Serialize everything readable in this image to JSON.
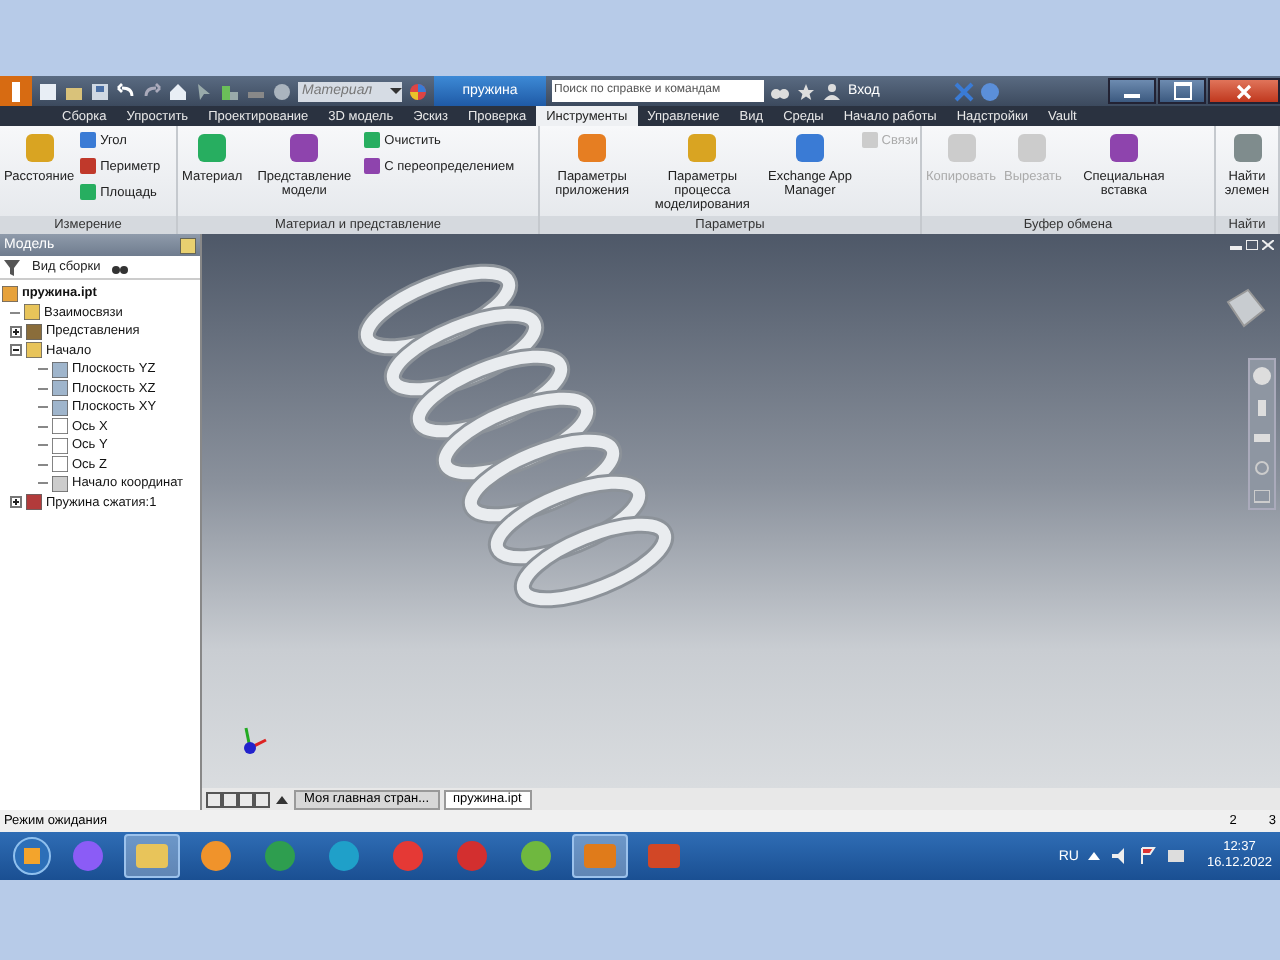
{
  "quick_access": {
    "material": "Материал"
  },
  "title": "пружина",
  "search": {
    "placeholder": "Поиск по справке и командам"
  },
  "sign_in": "Вход",
  "tabs": [
    {
      "label": "Сборка",
      "selected": false
    },
    {
      "label": "Упростить",
      "selected": false
    },
    {
      "label": "Проектирование",
      "selected": false
    },
    {
      "label": "3D модель",
      "selected": false
    },
    {
      "label": "Эскиз",
      "selected": false
    },
    {
      "label": "Проверка",
      "selected": false
    },
    {
      "label": "Инструменты",
      "selected": true
    },
    {
      "label": "Управление",
      "selected": false
    },
    {
      "label": "Вид",
      "selected": false
    },
    {
      "label": "Среды",
      "selected": false
    },
    {
      "label": "Начало работы",
      "selected": false
    },
    {
      "label": "Надстройки",
      "selected": false
    },
    {
      "label": "Vault",
      "selected": false
    }
  ],
  "panels": [
    {
      "title": "Измерение",
      "buttons": [
        {
          "label": "Расстояние",
          "kind": "large",
          "disabled": false
        },
        {
          "label": "Угол",
          "kind": "small",
          "disabled": false
        },
        {
          "label": "Периметр",
          "kind": "small",
          "disabled": false
        },
        {
          "label": "Площадь",
          "kind": "small",
          "disabled": false
        }
      ]
    },
    {
      "title": "Материал и представление",
      "buttons": [
        {
          "label": "Материал",
          "kind": "large",
          "disabled": false
        },
        {
          "label": "Представление модели",
          "kind": "large",
          "disabled": false
        },
        {
          "label": "Очистить",
          "kind": "small",
          "disabled": false
        },
        {
          "label": "С переопределением",
          "kind": "small",
          "disabled": false
        }
      ]
    },
    {
      "title": "Параметры",
      "buttons": [
        {
          "label": "Параметры приложения",
          "kind": "large",
          "disabled": false
        },
        {
          "label": "Параметры процесса моделирования",
          "kind": "large",
          "disabled": false
        },
        {
          "label": "Exchange App Manager",
          "kind": "large",
          "disabled": false
        },
        {
          "label": "Связи",
          "kind": "small",
          "disabled": true
        }
      ]
    },
    {
      "title": "Буфер обмена",
      "buttons": [
        {
          "label": "Копировать",
          "kind": "large",
          "disabled": true
        },
        {
          "label": "Вырезать",
          "kind": "large",
          "disabled": true
        },
        {
          "label": "Специальная вставка",
          "kind": "large",
          "disabled": false
        }
      ]
    },
    {
      "title": "Найти",
      "buttons": [
        {
          "label": "Найти элемен",
          "kind": "large",
          "disabled": false
        }
      ]
    }
  ],
  "browser": {
    "title": "Модель",
    "view": "Вид сборки",
    "tree": [
      {
        "label": "пружина.ipt",
        "kind": "part",
        "children": [
          {
            "label": "Взаимосвязи",
            "kind": "folder"
          },
          {
            "label": "Представления",
            "kind": "views",
            "expanded": false
          },
          {
            "label": "Начало",
            "kind": "origin",
            "expanded": true,
            "children": [
              {
                "label": "Плоскость YZ",
                "kind": "plane"
              },
              {
                "label": "Плоскость XZ",
                "kind": "plane"
              },
              {
                "label": "Плоскость XY",
                "kind": "plane"
              },
              {
                "label": "Ось X",
                "kind": "axis"
              },
              {
                "label": "Ось Y",
                "kind": "axis"
              },
              {
                "label": "Ось Z",
                "kind": "axis"
              },
              {
                "label": "Начало координат",
                "kind": "point"
              }
            ]
          },
          {
            "label": "Пружина сжатия:1",
            "kind": "feature",
            "expanded": false
          }
        ]
      }
    ]
  },
  "doc_tabs": [
    {
      "label": "Моя главная стран...",
      "selected": false
    },
    {
      "label": "пружина.ipt",
      "selected": true
    }
  ],
  "status": {
    "text": "Режим ожидания",
    "count_1": "2",
    "count_2": "3"
  },
  "taskbar": {
    "apps": [
      {
        "kind": "alice",
        "selected": false
      },
      {
        "kind": "folder",
        "selected": true
      },
      {
        "kind": "media",
        "selected": false
      },
      {
        "kind": "chrome",
        "selected": false
      },
      {
        "kind": "edge",
        "selected": false
      },
      {
        "kind": "yandex",
        "selected": false
      },
      {
        "kind": "opera",
        "selected": false
      },
      {
        "kind": "torrent",
        "selected": false
      },
      {
        "kind": "inventor",
        "selected": true
      },
      {
        "kind": "slides",
        "selected": false
      }
    ],
    "language": "RU",
    "time": "12:37",
    "date": "16.12.2022"
  }
}
